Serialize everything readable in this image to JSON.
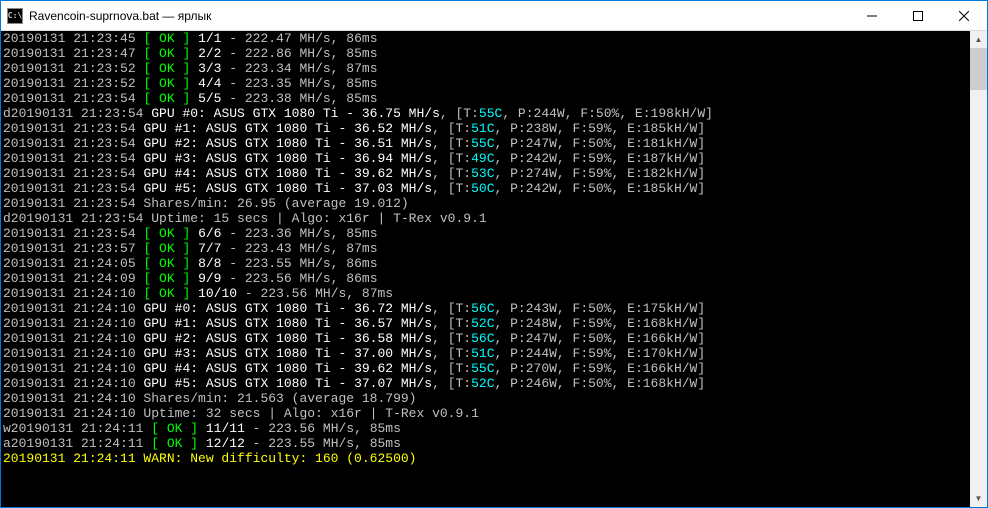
{
  "window": {
    "title": "Ravencoin-suprnova.bat — ярлык",
    "icon_label": "C:\\"
  },
  "lines": [
    {
      "type": "share",
      "ts": "20190131 21:23:45",
      "spre": "",
      "share": "1/1",
      "hr": "222.47",
      "ms": "86ms"
    },
    {
      "type": "share",
      "ts": "20190131 21:23:47",
      "spre": "",
      "share": "2/2",
      "hr": "222.86",
      "ms": "85ms"
    },
    {
      "type": "share",
      "ts": "20190131 21:23:52",
      "spre": "",
      "share": "3/3",
      "hr": "223.34",
      "ms": "87ms"
    },
    {
      "type": "share",
      "ts": "20190131 21:23:52",
      "spre": "",
      "share": "4/4",
      "hr": "223.35",
      "ms": "85ms"
    },
    {
      "type": "share",
      "ts": "20190131 21:23:54",
      "spre": "",
      "share": "5/5",
      "hr": "223.38",
      "ms": "85ms"
    },
    {
      "type": "gpu",
      "ts": "20190131 21:23:54",
      "dpre": "d",
      "idx": "0",
      "model": "ASUS GTX 1080 Ti",
      "hr": "36.75",
      "t": "55",
      "p": "244",
      "f": "50",
      "e": "198"
    },
    {
      "type": "gpu",
      "ts": "20190131 21:23:54",
      "dpre": "",
      "idx": "1",
      "model": "ASUS GTX 1080 Ti",
      "hr": "36.52",
      "t": "51",
      "p": "238",
      "f": "59",
      "e": "185"
    },
    {
      "type": "gpu",
      "ts": "20190131 21:23:54",
      "dpre": "",
      "idx": "2",
      "model": "ASUS GTX 1080 Ti",
      "hr": "36.51",
      "t": "55",
      "p": "247",
      "f": "50",
      "e": "181"
    },
    {
      "type": "gpu",
      "ts": "20190131 21:23:54",
      "dpre": "",
      "idx": "3",
      "model": "ASUS GTX 1080 Ti",
      "hr": "36.94",
      "t": "49",
      "p": "242",
      "f": "59",
      "e": "187"
    },
    {
      "type": "gpu",
      "ts": "20190131 21:23:54",
      "dpre": "",
      "idx": "4",
      "model": "ASUS GTX 1080 Ti",
      "hr": "39.62",
      "t": "53",
      "p": "274",
      "f": "59",
      "e": "182"
    },
    {
      "type": "gpu",
      "ts": "20190131 21:23:54",
      "dpre": "",
      "idx": "5",
      "model": "ASUS GTX 1080 Ti",
      "hr": "37.03",
      "t": "50",
      "p": "242",
      "f": "50",
      "e": "185"
    },
    {
      "type": "spm",
      "ts": "20190131 21:23:54",
      "spm": "26.95",
      "avg": "19.012"
    },
    {
      "type": "uptime",
      "ts": "20190131 21:23:54",
      "upre": "d",
      "uptime": "15 secs",
      "algo": "x16r",
      "ver": "T-Rex v0.9.1"
    },
    {
      "type": "share",
      "ts": "20190131 21:23:54",
      "spre": "",
      "share": "6/6",
      "hr": "223.36",
      "ms": "85ms"
    },
    {
      "type": "share",
      "ts": "20190131 21:23:57",
      "spre": "",
      "share": "7/7",
      "hr": "223.43",
      "ms": "87ms"
    },
    {
      "type": "share",
      "ts": "20190131 21:24:05",
      "spre": "",
      "share": "8/8",
      "hr": "223.55",
      "ms": "86ms"
    },
    {
      "type": "share",
      "ts": "20190131 21:24:09",
      "spre": "",
      "share": "9/9",
      "hr": "223.56",
      "ms": "86ms"
    },
    {
      "type": "share",
      "ts": "20190131 21:24:10",
      "spre": "",
      "share": "10/10",
      "hr": "223.56",
      "ms": "87ms"
    },
    {
      "type": "gpu",
      "ts": "20190131 21:24:10",
      "dpre": "",
      "idx": "0",
      "model": "ASUS GTX 1080 Ti",
      "hr": "36.72",
      "t": "56",
      "p": "243",
      "f": "50",
      "e": "175"
    },
    {
      "type": "gpu",
      "ts": "20190131 21:24:10",
      "dpre": "",
      "idx": "1",
      "model": "ASUS GTX 1080 Ti",
      "hr": "36.57",
      "t": "52",
      "p": "248",
      "f": "59",
      "e": "168"
    },
    {
      "type": "gpu",
      "ts": "20190131 21:24:10",
      "dpre": "",
      "idx": "2",
      "model": "ASUS GTX 1080 Ti",
      "hr": "36.58",
      "t": "56",
      "p": "247",
      "f": "50",
      "e": "166"
    },
    {
      "type": "gpu",
      "ts": "20190131 21:24:10",
      "dpre": "",
      "idx": "3",
      "model": "ASUS GTX 1080 Ti",
      "hr": "37.00",
      "t": "51",
      "p": "244",
      "f": "59",
      "e": "170"
    },
    {
      "type": "gpu",
      "ts": "20190131 21:24:10",
      "dpre": "",
      "idx": "4",
      "model": "ASUS GTX 1080 Ti",
      "hr": "39.62",
      "t": "55",
      "p": "270",
      "f": "59",
      "e": "166"
    },
    {
      "type": "gpu",
      "ts": "20190131 21:24:10",
      "dpre": "",
      "idx": "5",
      "model": "ASUS GTX 1080 Ti",
      "hr": "37.07",
      "t": "52",
      "p": "246",
      "f": "50",
      "e": "168"
    },
    {
      "type": "spm",
      "ts": "20190131 21:24:10",
      "spm": "21.563",
      "avg": "18.799"
    },
    {
      "type": "uptime",
      "ts": "20190131 21:24:10",
      "upre": "",
      "uptime": "32 secs",
      "algo": "x16r",
      "ver": "T-Rex v0.9.1"
    },
    {
      "type": "share",
      "ts": "20190131 21:24:11",
      "spre": "w",
      "share": "11/11",
      "hr": "223.56",
      "ms": "85ms"
    },
    {
      "type": "share",
      "ts": "20190131 21:24:11",
      "spre": "a",
      "share": "12/12",
      "hr": "223.55",
      "ms": "85ms"
    },
    {
      "type": "warn",
      "ts": "20190131 21:24:11",
      "msg": "WARN: New difficulty: 160 (0.62500)"
    },
    {
      "type": "blank"
    }
  ]
}
